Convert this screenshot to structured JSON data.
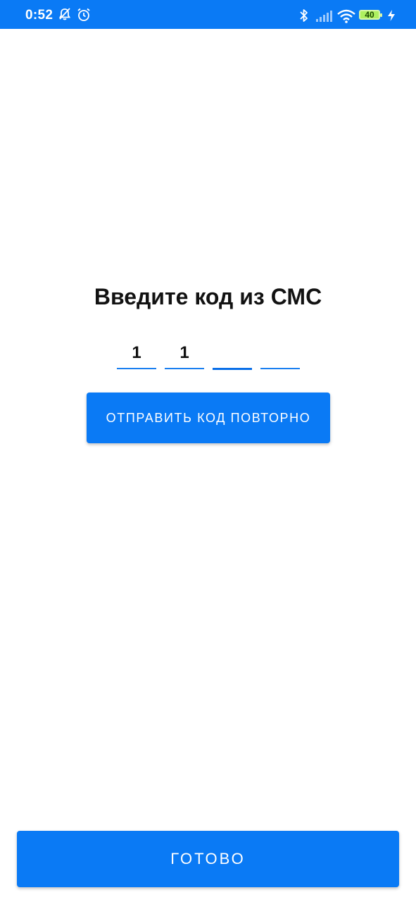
{
  "status_bar": {
    "time": "0:52",
    "battery_level": "40",
    "icons": [
      "bell-off-icon",
      "alarm-icon",
      "bluetooth-icon",
      "signal-icon",
      "wifi-icon",
      "battery-icon",
      "charging-icon"
    ],
    "background_color": "#0a7af5"
  },
  "verification": {
    "title": "Введите код из СМС",
    "digits": [
      "1",
      "1",
      "",
      ""
    ],
    "active_index": 2,
    "resend_label": "ОТПРАВИТЬ КОД ПОВТОРНО"
  },
  "footer": {
    "done_label": "ГОТОВО"
  },
  "colors": {
    "accent": "#0a7af5",
    "text": "#121212",
    "background": "#ffffff"
  }
}
